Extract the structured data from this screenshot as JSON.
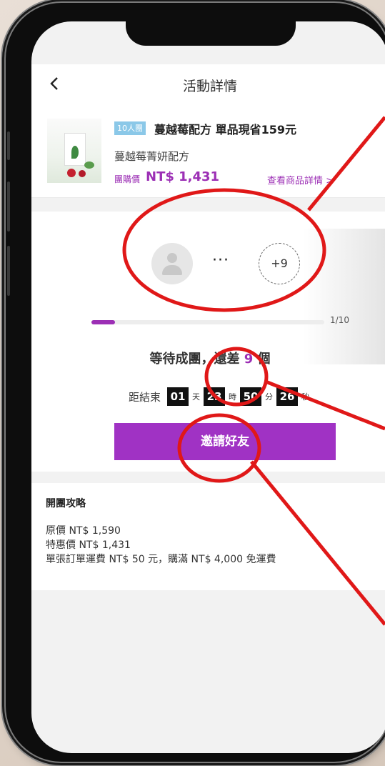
{
  "app": {
    "page_title": "活動詳情",
    "back_icon": "chevron-left-icon"
  },
  "product": {
    "badge": "10人團",
    "title": "蔓越莓配方 單品現省159元",
    "subtitle": "蔓越莓菁妍配方",
    "price_label": "團購價",
    "price": "NT$ 1,431",
    "detail_link": "查看商品詳情 >"
  },
  "group": {
    "more_members": "+9",
    "ellipsis": "···",
    "progress": {
      "current": 1,
      "total": 10,
      "text": "1/10"
    },
    "waiting_prefix": "等待成團，還差",
    "waiting_count": "9",
    "waiting_suffix": "個",
    "countdown": {
      "label": "距結束",
      "days": "01",
      "days_unit": "天",
      "hours": "23",
      "hours_unit": "時",
      "minutes": "50",
      "minutes_unit": "分",
      "seconds": "26",
      "seconds_unit": "秒"
    },
    "invite_button": "邀請好友"
  },
  "guide": {
    "title": "開團攻略",
    "original_price": "原價 NT$ 1,590",
    "special_price": "特惠價 NT$ 1,431",
    "shipping": "單張訂單運費 NT$ 50 元，購滿 NT$ 4,000 免運費"
  },
  "colors": {
    "accent": "#a032c4",
    "annotation": "#e01818"
  }
}
